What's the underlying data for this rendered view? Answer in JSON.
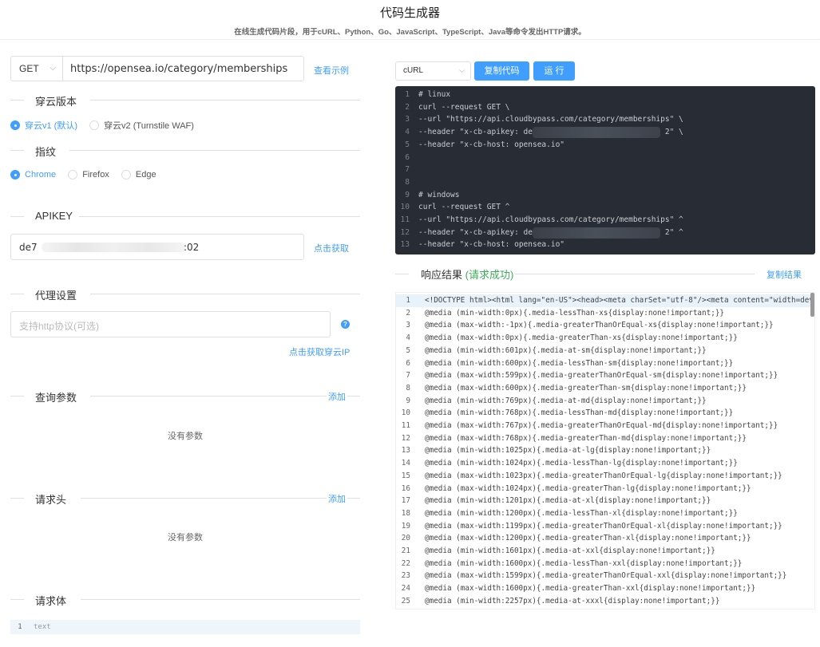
{
  "header": {
    "title": "代码生成器",
    "subtitle": "在线生成代码片段，用于cURL、Python、Go、JavaScript、TypeScript、Java等命令发出HTTP请求。"
  },
  "request": {
    "method": "GET",
    "url": "https://opensea.io/category/memberships",
    "example_link": "查看示例"
  },
  "version": {
    "label": "穿云版本",
    "options": [
      "穿云v1 (默认)",
      "穿云v2 (Turnstile WAF)"
    ],
    "selected": 0
  },
  "fingerprint": {
    "label": "指纹",
    "options": [
      "Chrome",
      "Firefox",
      "Edge"
    ],
    "selected": 0
  },
  "apikey": {
    "label": "APIKEY",
    "value_prefix": "de7",
    "value_suffix": ":02",
    "get_link": "点击获取"
  },
  "proxy": {
    "label": "代理设置",
    "placeholder": "支持http协议(可选)",
    "get_link": "点击获取穿云IP"
  },
  "query_params": {
    "label": "查询参数",
    "add": "添加",
    "empty": "没有参数"
  },
  "headers": {
    "label": "请求头",
    "add": "添加",
    "empty": "没有参数"
  },
  "body": {
    "label": "请求体",
    "line_number": "1",
    "placeholder": "text"
  },
  "toolbar": {
    "language": "cURL",
    "copy_code": "复制代码",
    "run": "运 行"
  },
  "code": {
    "lines": [
      "# linux",
      "curl --request GET \\",
      "--url \"https://api.cloudbypass.com/category/memberships\" \\",
      "--header \"x-cb-apikey: de72                           2\" \\",
      "--header \"x-cb-host: opensea.io\"",
      "",
      "",
      "",
      "# windows",
      "curl --request GET ^",
      "--url \"https://api.cloudbypass.com/category/memberships\" ^",
      "--header \"x-cb-apikey: de7                            2\" ^",
      "--header \"x-cb-host: opensea.io\""
    ]
  },
  "result": {
    "label": "响应结果",
    "status": "(请求成功)",
    "copy": "复制结果",
    "status_color": "#3dac5a",
    "lines": [
      "<!DOCTYPE html><html lang=\"en-US\"><head><meta charSet=\"utf-8\"/><meta content=\"width=dev",
      "@media (min-width:0px){.media-lessThan-xs{display:none!important;}}",
      "@media (max-width:-1px){.media-greaterThanOrEqual-xs{display:none!important;}}",
      "@media (max-width:0px){.media-greaterThan-xs{display:none!important;}}",
      "@media (min-width:601px){.media-at-sm{display:none!important;}}",
      "@media (min-width:600px){.media-lessThan-sm{display:none!important;}}",
      "@media (max-width:599px){.media-greaterThanOrEqual-sm{display:none!important;}}",
      "@media (max-width:600px){.media-greaterThan-sm{display:none!important;}}",
      "@media (min-width:769px){.media-at-md{display:none!important;}}",
      "@media (min-width:768px){.media-lessThan-md{display:none!important;}}",
      "@media (max-width:767px){.media-greaterThanOrEqual-md{display:none!important;}}",
      "@media (max-width:768px){.media-greaterThan-md{display:none!important;}}",
      "@media (min-width:1025px){.media-at-lg{display:none!important;}}",
      "@media (min-width:1024px){.media-lessThan-lg{display:none!important;}}",
      "@media (max-width:1023px){.media-greaterThanOrEqual-lg{display:none!important;}}",
      "@media (max-width:1024px){.media-greaterThan-lg{display:none!important;}}",
      "@media (min-width:1201px){.media-at-xl{display:none!important;}}",
      "@media (min-width:1200px){.media-lessThan-xl{display:none!important;}}",
      "@media (max-width:1199px){.media-greaterThanOrEqual-xl{display:none!important;}}",
      "@media (max-width:1200px){.media-greaterThan-xl{display:none!important;}}",
      "@media (min-width:1601px){.media-at-xxl{display:none!important;}}",
      "@media (min-width:1600px){.media-lessThan-xxl{display:none!important;}}",
      "@media (max-width:1599px){.media-greaterThanOrEqual-xxl{display:none!important;}}",
      "@media (max-width:1600px){.media-greaterThan-xxl{display:none!important;}}",
      "@media (min-width:2257px){.media-at-xxxl{display:none!important;}}"
    ]
  }
}
